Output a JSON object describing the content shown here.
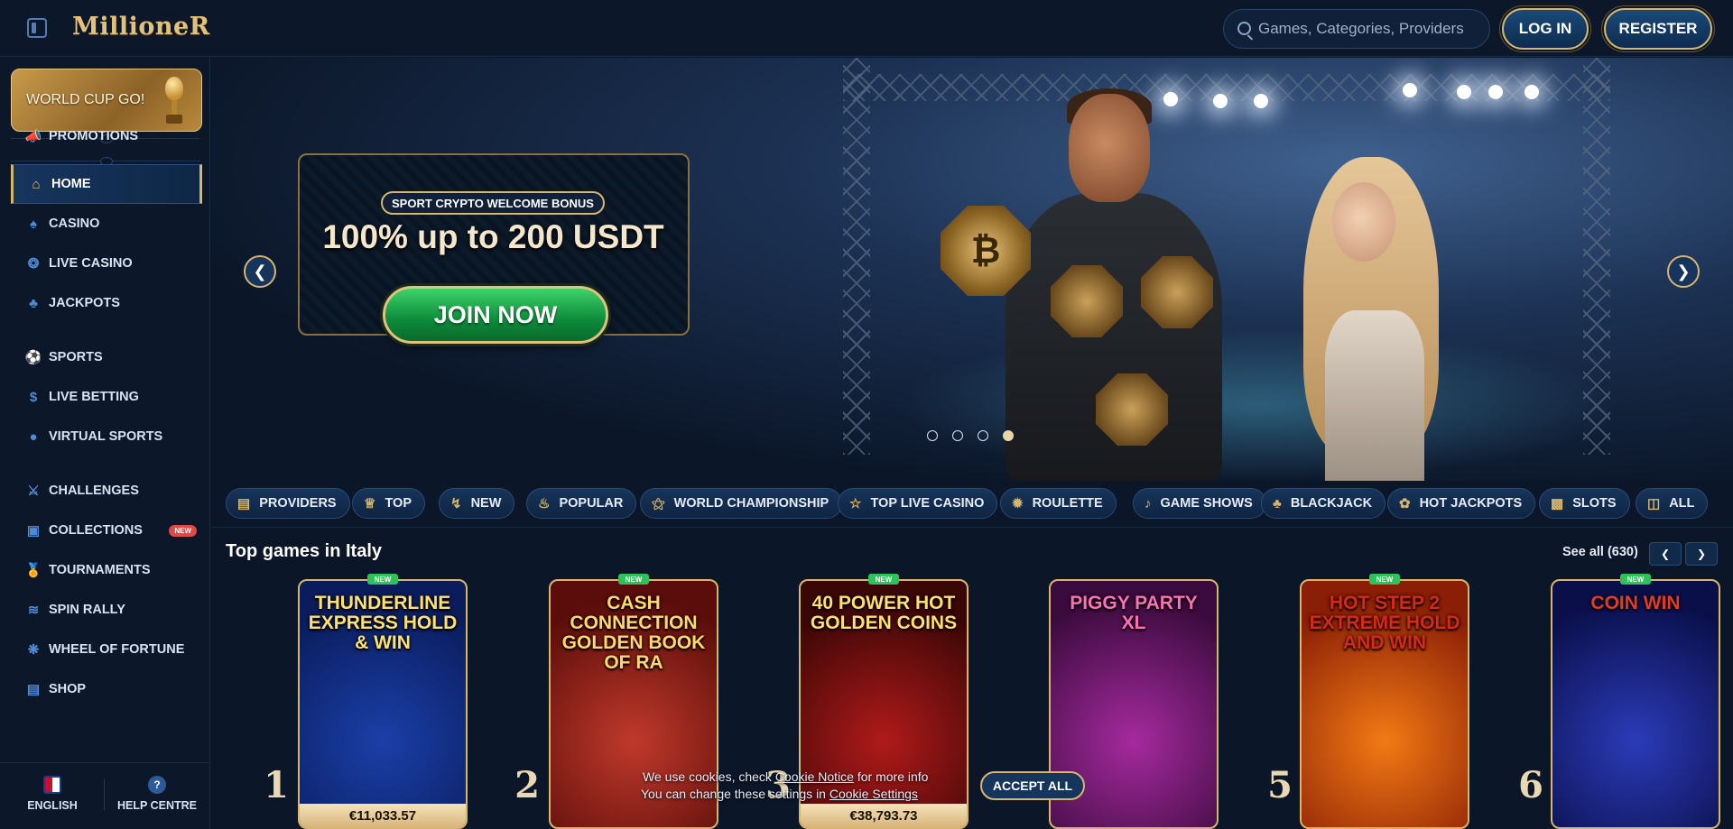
{
  "header": {
    "logo": "MillioneR",
    "search_placeholder": "Games, Categories, Providers",
    "login_label": "LOG IN",
    "register_label": "REGISTER"
  },
  "sidebar": {
    "world_cup_banner": "WORLD CUP GO!",
    "items": [
      {
        "label": "PROMOTIONS",
        "icon": "megaphone-icon"
      },
      {
        "label": "HOME",
        "icon": "home-icon",
        "active": true
      },
      {
        "label": "CASINO",
        "icon": "spade-icon"
      },
      {
        "label": "LIVE CASINO",
        "icon": "chip-icon"
      },
      {
        "label": "JACKPOTS",
        "icon": "clover-icon"
      },
      {
        "label": "SPORTS",
        "icon": "football-icon"
      },
      {
        "label": "LIVE BETTING",
        "icon": "dollar-coin-icon"
      },
      {
        "label": "VIRTUAL SPORTS",
        "icon": "globe-icon"
      },
      {
        "label": "CHALLENGES",
        "icon": "crossed-swords-icon"
      },
      {
        "label": "COLLECTIONS",
        "icon": "cards-icon",
        "badge": "NEW"
      },
      {
        "label": "TOURNAMENTS",
        "icon": "medal-icon"
      },
      {
        "label": "SPIN RALLY",
        "icon": "car-icon"
      },
      {
        "label": "WHEEL OF FORTUNE",
        "icon": "wheel-icon"
      },
      {
        "label": "SHOP",
        "icon": "basket-icon"
      }
    ],
    "footer": {
      "language": "ENGLISH",
      "help": "HELP CENTRE"
    }
  },
  "hero": {
    "promo_label": "SPORT CRYPTO WELCOME BONUS",
    "promo_title": "100% up to 200 USDT",
    "cta": "JOIN NOW",
    "badge_glyph": "₿",
    "slides": 4,
    "active_slide": 4
  },
  "categories": [
    {
      "label": "PROVIDERS",
      "icon": "book-icon"
    },
    {
      "label": "TOP",
      "icon": "crown-icon"
    },
    {
      "label": "NEW",
      "icon": "lightning-icon"
    },
    {
      "label": "POPULAR",
      "icon": "flame-icon"
    },
    {
      "label": "WORLD CHAMPIONSHIP",
      "icon": "trophy-icon"
    },
    {
      "label": "TOP LIVE CASINO",
      "icon": "star-icon"
    },
    {
      "label": "ROULETTE",
      "icon": "roulette-icon"
    },
    {
      "label": "GAME SHOWS",
      "icon": "microphone-icon"
    },
    {
      "label": "BLACKJACK",
      "icon": "cards-icon"
    },
    {
      "label": "HOT JACKPOTS",
      "icon": "comet-icon"
    },
    {
      "label": "SLOTS",
      "icon": "slot-machine-icon"
    },
    {
      "label": "ALL",
      "icon": "grid-icon"
    }
  ],
  "top_games": {
    "title": "Top games in Italy",
    "see_all": "See all (630)",
    "games": [
      {
        "rank": "1",
        "name": "THUNDERLINE EXPRESS HOLD & WIN",
        "badge": "NEW",
        "jackpot": "€11,033.57",
        "colors": [
          "#1b3fa8",
          "#0a1c5c"
        ],
        "text_color": "#ffe26b"
      },
      {
        "rank": "2",
        "name": "CASH CONNECTION GOLDEN BOOK OF RA",
        "badge": "NEW",
        "jackpot": "",
        "colors": [
          "#c0392b",
          "#5a0d0a"
        ],
        "text_color": "#ffd86a"
      },
      {
        "rank": "3",
        "name": "40 POWER HOT GOLDEN COINS",
        "badge": "NEW",
        "jackpot": "€38,793.73",
        "colors": [
          "#b01a1a",
          "#3a0606"
        ],
        "text_color": "#ffdf6b"
      },
      {
        "rank": "",
        "name": "PIGGY PARTY XL",
        "badge": "",
        "jackpot": "",
        "colors": [
          "#a52a9e",
          "#3b0b3d"
        ],
        "text_color": "#ff6fb5"
      },
      {
        "rank": "5",
        "name": "HOT STEP 2 EXTREME HOLD AND WIN",
        "badge": "NEW",
        "jackpot": "",
        "colors": [
          "#f27a14",
          "#8a1e06"
        ],
        "text_color": "#d8281a"
      },
      {
        "rank": "6",
        "name": "COIN WIN",
        "badge": "NEW",
        "jackpot": "",
        "colors": [
          "#2b3bb8",
          "#0a0f4a"
        ],
        "text_color": "#e33a2a"
      }
    ]
  },
  "cookie": {
    "line1_a": "We use cookies, check ",
    "line1_link": "Cookie Notice",
    "line1_b": " for more info",
    "line2_a": "You can change these settings in ",
    "line2_link": "Cookie Settings",
    "accept": "ACCEPT ALL"
  },
  "colors": {
    "background": "#0b1628",
    "gold": "#d7b66c",
    "accent_blue": "#16355d",
    "cta_green": "#1aa34a"
  }
}
